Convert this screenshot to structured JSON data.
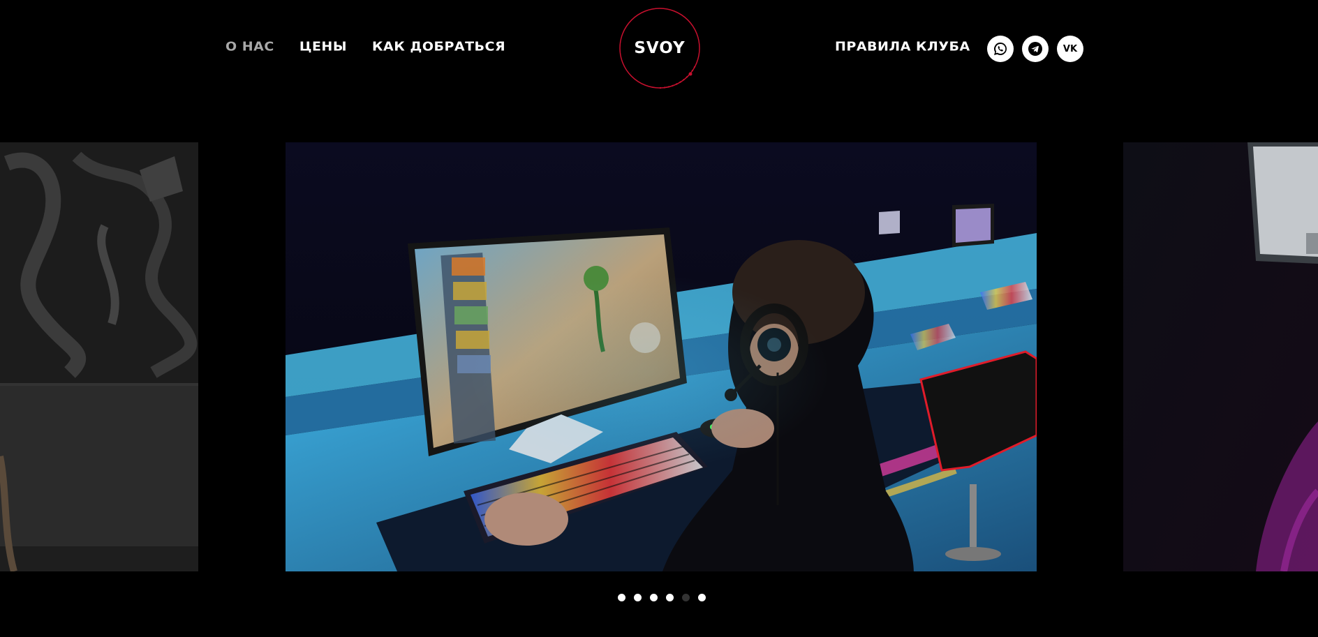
{
  "nav": {
    "items": [
      {
        "label": "О НАС",
        "active": true
      },
      {
        "label": "ЦЕНЫ",
        "active": false
      },
      {
        "label": "КАК ДОБРАТЬСЯ",
        "active": false
      }
    ],
    "rules_label": "ПРАВИЛА КЛУБА"
  },
  "logo": {
    "text": "SVOY",
    "ring_color": "#c8102e"
  },
  "socials": [
    {
      "name": "whatsapp-icon"
    },
    {
      "name": "telegram-icon"
    },
    {
      "name": "vk-icon",
      "text": "VK"
    }
  ],
  "carousel": {
    "slides": [
      {
        "name": "graffiti-wall-slide"
      },
      {
        "name": "gamer-at-pc-slide"
      },
      {
        "name": "club-room-slide"
      }
    ],
    "dots": [
      {
        "active": false
      },
      {
        "active": false
      },
      {
        "active": false
      },
      {
        "active": false
      },
      {
        "active": true
      },
      {
        "active": false
      }
    ]
  },
  "colors": {
    "background": "#000000",
    "accent": "#c8102e",
    "text": "#ffffff"
  }
}
